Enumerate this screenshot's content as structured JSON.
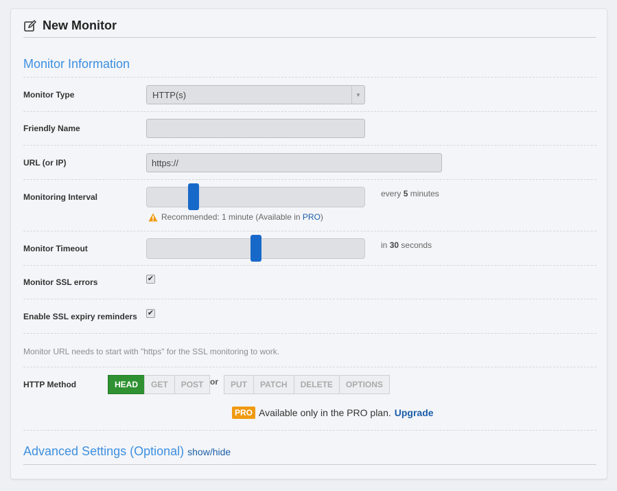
{
  "header": {
    "title": "New Monitor",
    "icon": "edit-icon"
  },
  "section": {
    "title": "Monitor Information"
  },
  "fields": {
    "monitor_type": {
      "label": "Monitor Type",
      "value": "HTTP(s)"
    },
    "friendly_name": {
      "label": "Friendly Name",
      "value": ""
    },
    "url": {
      "label": "URL (or IP)",
      "value": "https://"
    },
    "interval": {
      "label": "Monitoring Interval",
      "aside_prefix": "every",
      "value": "5",
      "aside_suffix": "minutes",
      "slider_fraction": 0.2,
      "warning_text": "Recommended: 1 minute (Available in",
      "warning_link": "PRO",
      "warning_close": ")"
    },
    "timeout": {
      "label": "Monitor Timeout",
      "aside_prefix": "in",
      "value": "30",
      "aside_suffix": "seconds",
      "slider_fraction": 0.5
    },
    "ssl_errors": {
      "label": "Monitor SSL errors",
      "checked": true
    },
    "ssl_expiry": {
      "label": "Enable SSL expiry reminders",
      "checked": true
    }
  },
  "ssl_note": "Monitor URL needs to start with \"https\" for the SSL monitoring to work.",
  "http_method": {
    "label": "HTTP Method",
    "group1": [
      "HEAD",
      "GET",
      "POST"
    ],
    "or": "or",
    "group2": [
      "PUT",
      "PATCH",
      "DELETE",
      "OPTIONS"
    ],
    "selected": "HEAD"
  },
  "pro_notice": {
    "badge": "PRO",
    "text": "Available only in the PRO plan.",
    "link": "Upgrade"
  },
  "advanced": {
    "title": "Advanced Settings (Optional)",
    "toggle": "show/hide"
  },
  "colors": {
    "accent": "#3d8fe0",
    "primary": "#1769c9",
    "success": "#2f9132",
    "warning": "#f09a12"
  }
}
